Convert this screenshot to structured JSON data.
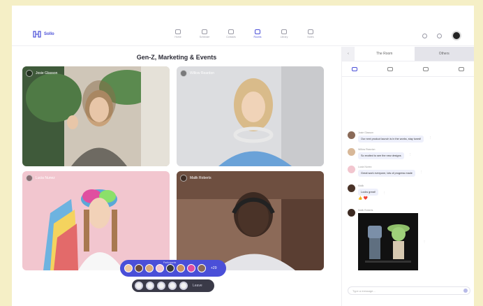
{
  "app": {
    "logo_text": "Sollo"
  },
  "nav": [
    {
      "label": "Home",
      "icon": "home-icon",
      "active": false
    },
    {
      "label": "Schedule",
      "icon": "calendar-icon",
      "active": false
    },
    {
      "label": "Contacts",
      "icon": "contacts-icon",
      "active": false
    },
    {
      "label": "Rooms",
      "icon": "video-icon",
      "active": true
    },
    {
      "label": "Library",
      "icon": "library-icon",
      "active": false
    },
    {
      "label": "Notes",
      "icon": "notes-icon",
      "active": false
    }
  ],
  "meeting": {
    "title": "Gen-Z, Marketing & Events"
  },
  "participants": [
    {
      "name": "Josie Glasson"
    },
    {
      "name": "Willow Reardon"
    },
    {
      "name": "Lucia Nunez"
    },
    {
      "name": "Malik Roberts"
    }
  ],
  "people_bar": {
    "label": "Participants",
    "count": "+29"
  },
  "controls": {
    "leave_label": "Leave"
  },
  "side": {
    "tabs": [
      "The Room",
      "Others"
    ],
    "messages": [
      {
        "name": "Josie Glasson",
        "text": "Our next product launch is in the works, stay tuned!"
      },
      {
        "name": "Willow Reardon",
        "text": "So excited to see the new designs"
      },
      {
        "name": "Lucia Nunez",
        "text": "Great work everyone, lots of progress made"
      },
      {
        "name": "Malik",
        "text": "Looks great!"
      },
      {
        "name": "Malik Roberts",
        "text": ""
      }
    ],
    "composer_placeholder": "Type a message..."
  },
  "colors": {
    "accent": "#4a4fd8"
  }
}
